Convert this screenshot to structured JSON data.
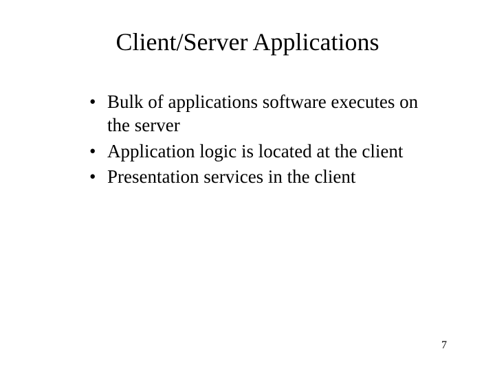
{
  "slide": {
    "title": "Client/Server Applications",
    "bullets": [
      "Bulk of applications software executes on the server",
      "Application logic is located at the client",
      "Presentation services in the client"
    ],
    "page_number": "7"
  }
}
